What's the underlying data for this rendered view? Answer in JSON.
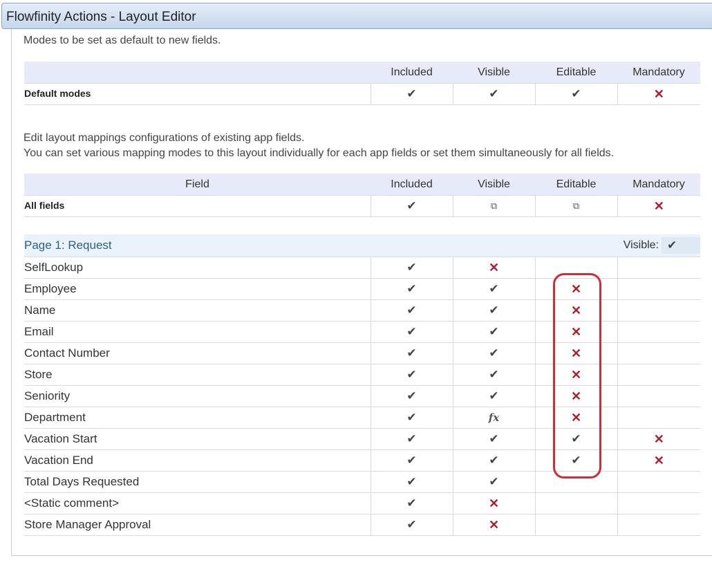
{
  "window": {
    "title": "Flowfinity Actions - Layout Editor"
  },
  "defaults_section": {
    "description": "Modes to be set as default to new fields.",
    "columns": [
      "",
      "Included",
      "Visible",
      "Editable",
      "Mandatory"
    ],
    "row": {
      "label": "Default modes",
      "modes": [
        "check",
        "check",
        "check",
        "cross"
      ]
    }
  },
  "mappings_section": {
    "description_line1": "Edit layout mappings configurations of existing app fields.",
    "description_line2": "You can set various mapping modes to this layout individually for each app fields or set them simultaneously for all fields.",
    "columns": [
      "Field",
      "Included",
      "Visible",
      "Editable",
      "Mandatory"
    ],
    "all_fields": {
      "label": "All fields",
      "modes": [
        "check",
        "partial",
        "partial",
        "cross"
      ]
    },
    "page": {
      "label": "Page 1: Request",
      "visible_label": "Visible:",
      "visible_value": "check"
    },
    "fields": [
      {
        "label": "SelfLookup",
        "modes": [
          "check",
          "cross",
          "",
          ""
        ]
      },
      {
        "label": "Employee",
        "modes": [
          "check",
          "check",
          "cross",
          ""
        ]
      },
      {
        "label": "Name",
        "modes": [
          "check",
          "check",
          "cross",
          ""
        ]
      },
      {
        "label": "Email",
        "modes": [
          "check",
          "check",
          "cross",
          ""
        ]
      },
      {
        "label": "Contact Number",
        "modes": [
          "check",
          "check",
          "cross",
          ""
        ]
      },
      {
        "label": "Store",
        "modes": [
          "check",
          "check",
          "cross",
          ""
        ]
      },
      {
        "label": "Seniority",
        "modes": [
          "check",
          "check",
          "cross",
          ""
        ]
      },
      {
        "label": "Department",
        "modes": [
          "check",
          "fx",
          "cross",
          ""
        ]
      },
      {
        "label": "Vacation Start",
        "modes": [
          "check",
          "check",
          "check",
          "cross"
        ]
      },
      {
        "label": "Vacation End",
        "modes": [
          "check",
          "check",
          "check",
          "cross"
        ]
      },
      {
        "label": "Total Days Requested",
        "modes": [
          "check",
          "check",
          "",
          ""
        ]
      },
      {
        "label": "<Static comment>",
        "modes": [
          "check",
          "cross",
          "",
          ""
        ]
      },
      {
        "label": "Store Manager Approval",
        "modes": [
          "check",
          "cross",
          "",
          ""
        ]
      }
    ]
  },
  "icons": {
    "check": "checkmark-icon",
    "cross": "cross-icon",
    "partial": "partial-copy-icon",
    "fx": "formula-icon"
  },
  "colors": {
    "cross": "#b01c2e",
    "header_bg": "#e7eaf8",
    "page_row_bg": "#eaf3fb",
    "highlight": "#d42a37"
  }
}
